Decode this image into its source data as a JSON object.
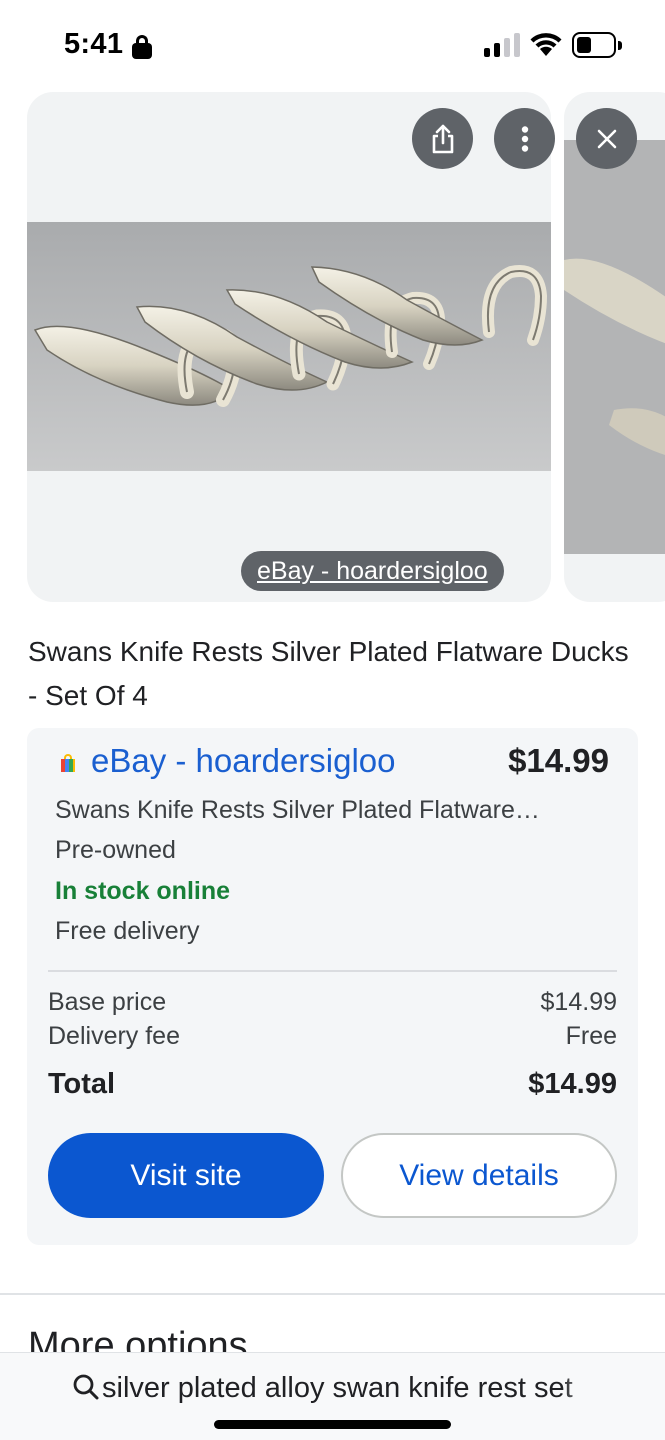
{
  "status_bar": {
    "time": "5:41"
  },
  "carousel": {
    "source_chip": "eBay - hoardersigloo",
    "share_icon": "share-icon",
    "more_icon": "more-vert-icon",
    "close_icon": "close-icon"
  },
  "product": {
    "title": "Swans Knife Rests Silver Plated Flatware Ducks - Set Of 4"
  },
  "offer": {
    "seller": "eBay - hoardersigloo",
    "price": "$14.99",
    "description": "Swans Knife Rests Silver Plated Flatware…",
    "condition": "Pre-owned",
    "stock": "In stock online",
    "delivery": "Free delivery",
    "breakdown": {
      "base_label": "Base price",
      "base_value": "$14.99",
      "fee_label": "Delivery fee",
      "fee_value": "Free",
      "total_label": "Total",
      "total_value": "$14.99"
    },
    "visit_label": "Visit site",
    "details_label": "View details"
  },
  "more_options": {
    "heading": "More options"
  },
  "search": {
    "query": "silver plated alloy swan knife rest set"
  },
  "colors": {
    "link_blue": "#1a5fd0",
    "primary_button": "#0b57d0",
    "in_stock_green": "#188038",
    "card_background": "#f4f6f8"
  }
}
